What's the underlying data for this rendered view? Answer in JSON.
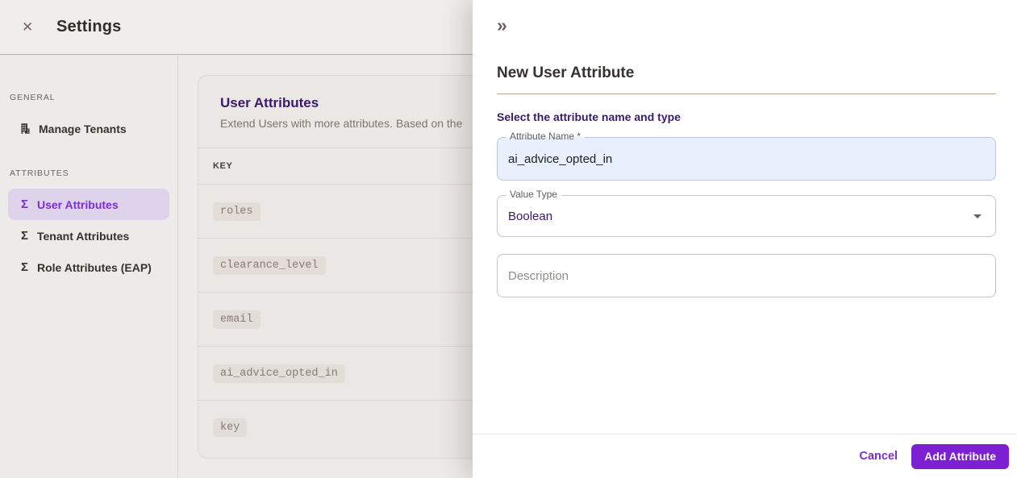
{
  "header": {
    "title": "Settings"
  },
  "icons": {
    "close": "✕",
    "collapse": "»",
    "sigma": "Σ"
  },
  "sidebar": {
    "sections": [
      {
        "label": "GENERAL",
        "items": [
          {
            "label": "Manage Tenants",
            "icon": "building-icon",
            "selected": false
          }
        ]
      },
      {
        "label": "ATTRIBUTES",
        "items": [
          {
            "label": "User Attributes",
            "icon": "sigma-icon",
            "selected": true
          },
          {
            "label": "Tenant Attributes",
            "icon": "sigma-icon",
            "selected": false
          },
          {
            "label": "Role Attributes (EAP)",
            "icon": "sigma-icon",
            "selected": false
          }
        ]
      }
    ]
  },
  "main": {
    "card": {
      "title": "User Attributes",
      "subtitle": "Extend Users with more attributes. Based on the",
      "table": {
        "columns": [
          "KEY"
        ],
        "rows": [
          "roles",
          "clearance_level",
          "email",
          "ai_advice_opted_in",
          "key"
        ]
      }
    }
  },
  "drawer": {
    "title": "New User Attribute",
    "section_label": "Select the attribute name and type",
    "fields": {
      "attribute_name": {
        "label": "Attribute Name *",
        "value": "ai_advice_opted_in"
      },
      "value_type": {
        "label": "Value Type",
        "value": "Boolean"
      },
      "description": {
        "placeholder": "Description"
      }
    },
    "footer": {
      "cancel_label": "Cancel",
      "submit_label": "Add Attribute"
    }
  },
  "colors": {
    "accent_purple": "#7d20d4",
    "selected_item_bg": "#ded3ea",
    "selected_item_text": "#7b2ed6",
    "heading_purple": "#3b1a6d",
    "value_type_text": "#3a1668",
    "name_field_fill": "#e8f0fd",
    "divider_brown": "#c0a591",
    "page_bg": "#edebe9",
    "chip_bg": "#e3ddd8",
    "drawer_bg": "#ffffff"
  }
}
